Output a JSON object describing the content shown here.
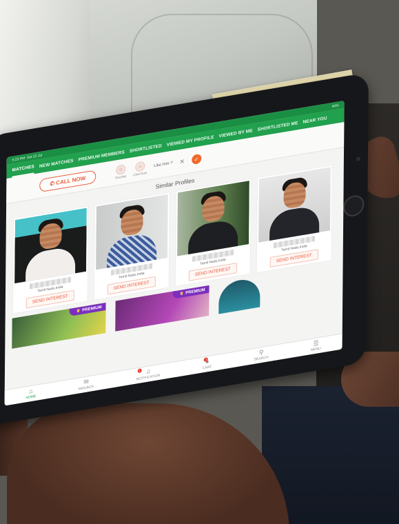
{
  "status_bar": {
    "time": "5:23 PM",
    "date": "Sat 22 Jul",
    "battery": "40%"
  },
  "nav": {
    "tabs": [
      {
        "label": "MATCHES"
      },
      {
        "label": "NEW MATCHES"
      },
      {
        "label": "PREMIUM MEMBERS"
      },
      {
        "label": "SHORTLISTED"
      },
      {
        "label": "VIEWED MY PROFILE"
      },
      {
        "label": "VIEWED BY ME"
      },
      {
        "label": "SHORTLISTED ME"
      },
      {
        "label": "NEAR YOU"
      }
    ]
  },
  "actions": {
    "call_now": "CALL NOW",
    "shortlist": "Shortlist",
    "chat_now": "Chat Now",
    "like_prompt": "Like him ?"
  },
  "similar": {
    "title": "Similar Profiles",
    "profiles": [
      {
        "location": "Tamil Nadu,India",
        "button": "SEND INTEREST"
      },
      {
        "location": "Tamil Nadu,India",
        "button": "SEND INTEREST"
      },
      {
        "location": "Tamil Nadu,India",
        "button": "SEND INTEREST"
      },
      {
        "location": "Tamil Nadu,India",
        "button": "SEND INTEREST"
      }
    ],
    "premium_label": "PREMIUM"
  },
  "bottom_nav": {
    "items": [
      {
        "label": "HOME",
        "icon": "home-icon"
      },
      {
        "label": "MAILBOX",
        "icon": "mailbox-icon"
      },
      {
        "label": "NOTIFICATION",
        "icon": "bell-icon",
        "badge": "1"
      },
      {
        "label": "CHAT",
        "icon": "chat-icon",
        "badge": "1"
      },
      {
        "label": "SEARCH",
        "icon": "search-icon"
      },
      {
        "label": "MENU",
        "icon": "menu-icon"
      }
    ]
  },
  "colors": {
    "brand_green": "#21a04d",
    "accent_orange": "#e85b3a",
    "premium_purple": "#7b2fbe"
  }
}
